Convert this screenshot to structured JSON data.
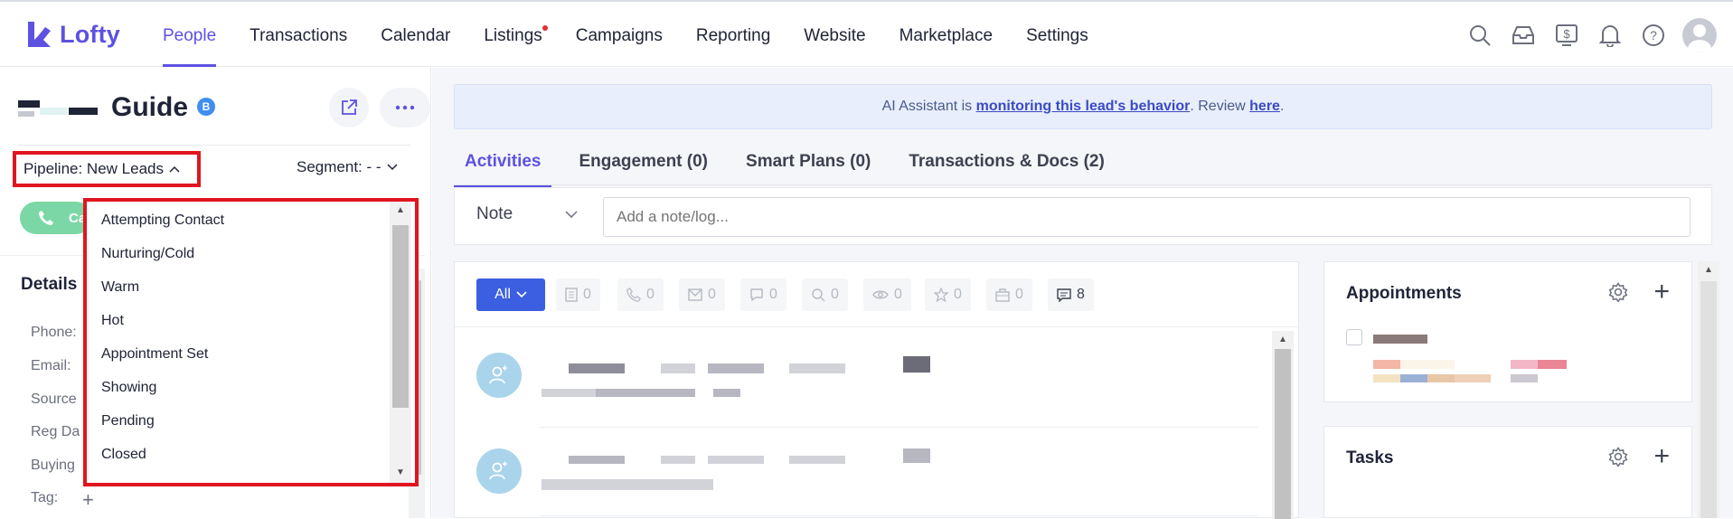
{
  "app": {
    "logo_text": "Lofty",
    "brand_color": "#5d51e2"
  },
  "nav": {
    "items": [
      {
        "label": "People",
        "active": true
      },
      {
        "label": "Transactions"
      },
      {
        "label": "Calendar"
      },
      {
        "label": "Listings",
        "dot": true
      },
      {
        "label": "Campaigns"
      },
      {
        "label": "Reporting"
      },
      {
        "label": "Website"
      },
      {
        "label": "Marketplace"
      },
      {
        "label": "Settings"
      }
    ],
    "icons": [
      "search-icon",
      "inbox-icon",
      "billing-icon",
      "bell-icon",
      "help-icon",
      "avatar"
    ]
  },
  "lead": {
    "name": "Guide",
    "badge": "B",
    "pipeline_label": "Pipeline: New Leads",
    "segment_label": "Segment: - -",
    "call_label": "Ca"
  },
  "pipeline_options": [
    "Attempting Contact",
    "Nurturing/Cold",
    "Warm",
    "Hot",
    "Appointment Set",
    "Showing",
    "Pending",
    "Closed"
  ],
  "details": {
    "title": "Details",
    "fields": [
      "Phone:",
      "Email:",
      "Source",
      "Reg Da",
      "Buying",
      "Tag:"
    ]
  },
  "banner": {
    "prefix": "AI Assistant is ",
    "link1": "monitoring this lead's behavior",
    "middle": ". Review ",
    "link2": "here",
    "suffix": "."
  },
  "tabs": [
    {
      "label": "Activities",
      "active": true
    },
    {
      "label": "Engagement (0)"
    },
    {
      "label": "Smart Plans (0)"
    },
    {
      "label": "Transactions & Docs (2)"
    }
  ],
  "note": {
    "type_label": "Note",
    "placeholder": "Add a note/log..."
  },
  "filters": {
    "all_label": "All",
    "chips": [
      {
        "icon": "document-icon",
        "count": "0"
      },
      {
        "icon": "phone-icon",
        "count": "0"
      },
      {
        "icon": "mail-icon",
        "count": "0"
      },
      {
        "icon": "chat-icon",
        "count": "0"
      },
      {
        "icon": "search-icon",
        "count": "0"
      },
      {
        "icon": "eye-icon",
        "count": "0"
      },
      {
        "icon": "star-icon",
        "count": "0"
      },
      {
        "icon": "briefcase-icon",
        "count": "0"
      },
      {
        "icon": "note-icon",
        "count": "8"
      }
    ]
  },
  "appointments": {
    "title": "Appointments"
  },
  "tasks": {
    "title": "Tasks"
  }
}
